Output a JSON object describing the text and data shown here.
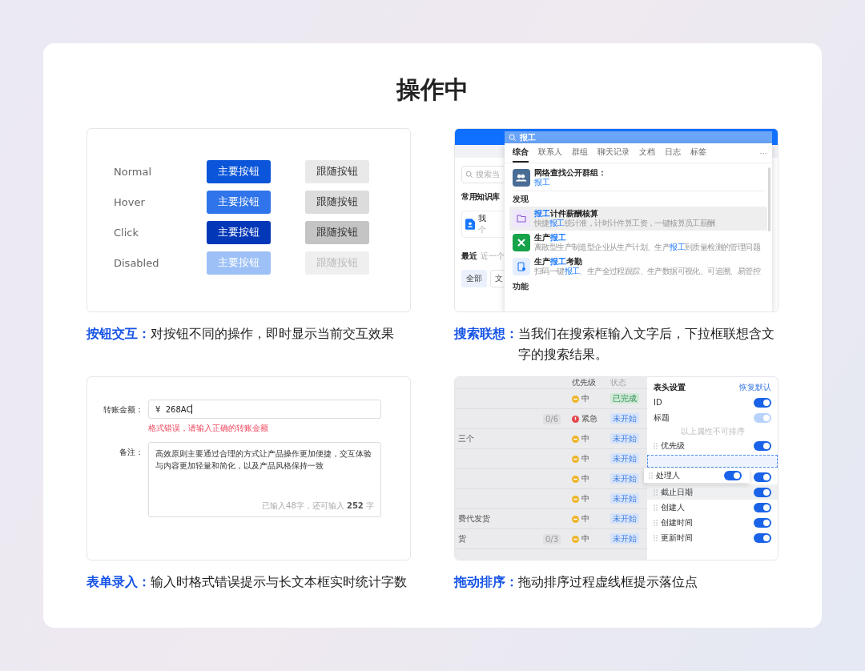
{
  "title": "操作中",
  "button_demo": {
    "rows": [
      {
        "kind": "normal",
        "label": "Normal",
        "primary": "主要按钮",
        "secondary": "跟随按钮"
      },
      {
        "kind": "hover",
        "label": "Hover",
        "primary": "主要按钮",
        "secondary": "跟随按钮"
      },
      {
        "kind": "click",
        "label": "Click",
        "primary": "主要按钮",
        "secondary": "跟随按钮"
      },
      {
        "kind": "disabled",
        "label": "Disabled",
        "primary": "主要按钮",
        "secondary": "跟随按钮"
      }
    ],
    "caption": {
      "label": "按钮交互：",
      "text": "对按钮不同的操作，即时显示当前交互效果"
    }
  },
  "search_demo": {
    "page": {
      "search_placeholder": "搜索当",
      "section_title": "常用知识库",
      "card_title": "我",
      "card_subtitle": "个",
      "recent_title": "最近",
      "recent_hint": "近一个",
      "chips": [
        {
          "label": "全部",
          "selected": true
        },
        {
          "label": "文",
          "selected": false
        }
      ]
    },
    "query": "报工",
    "tabs": [
      {
        "label": "综合",
        "selected": true
      },
      {
        "label": "联系人",
        "selected": false
      },
      {
        "label": "群组",
        "selected": false
      },
      {
        "label": "聊天记录",
        "selected": false
      },
      {
        "label": "文档",
        "selected": false
      },
      {
        "label": "日志",
        "selected": false
      },
      {
        "label": "标签",
        "selected": false
      }
    ],
    "more": "···",
    "group_row": {
      "title": "网络查找公开群组：",
      "keyword": "报工"
    },
    "sections": [
      {
        "title": "发现",
        "items": [
          {
            "kind": "salary",
            "selected": true,
            "title": [
              {
                "text": "报工",
                "match": true
              },
              {
                "text": "计件薪酬核算",
                "match": false
              }
            ],
            "description": [
              {
                "text": "快捷",
                "match": false
              },
              {
                "text": "报工",
                "match": true
              },
              {
                "text": "统计准，计时计件算工资，一键核算员工薪酬",
                "match": false
              }
            ]
          },
          {
            "kind": "tools",
            "selected": false,
            "title": [
              {
                "text": "生产",
                "match": false
              },
              {
                "text": "报工",
                "match": true
              }
            ],
            "description": [
              {
                "text": "离散型生产制造型企业从生产计划、生产",
                "match": false
              },
              {
                "text": "报工",
                "match": true
              },
              {
                "text": "到质量检测的管理问题",
                "match": false
              }
            ]
          },
          {
            "kind": "attendance",
            "selected": false,
            "title": [
              {
                "text": "生产",
                "match": false
              },
              {
                "text": "报工",
                "match": true
              },
              {
                "text": "考勤",
                "match": false
              }
            ],
            "description": [
              {
                "text": "扫码一键",
                "match": false
              },
              {
                "text": "报工",
                "match": true
              },
              {
                "text": "、生产全过程跟踪、生产数据可视化、可追溯、易管控",
                "match": false
              }
            ]
          }
        ]
      },
      {
        "title": "功能"
      }
    ],
    "caption": {
      "label": "搜索联想：",
      "text": "当我们在搜索框输入文字后，下拉框联想含文字的搜索结果。"
    }
  },
  "form_demo": {
    "amount_label": "转账金额：",
    "amount_value": "¥  268AC",
    "error": "格式错误，请输入正确的转账金额",
    "note_label": "备注：",
    "note_value": "高效原则主要通过合理的方式让产品操作更加便捷，交互体验与内容更加轻量和简化，以及产品风格保持一致",
    "counter": "已输入48字，还可输入 **252** 字",
    "caption": {
      "label": "表单录入：",
      "text": "输入时格式错误提示与长文本框实时统计字数"
    }
  },
  "sort_demo": {
    "columns": [
      "优先级",
      "状态"
    ],
    "rows": [
      {
        "priority": {
          "text": "中",
          "kind": "normal"
        },
        "status": {
          "text": "已完成",
          "kind": "done"
        }
      },
      {
        "count": "0/6",
        "priority": {
          "text": "紧急",
          "kind": "urgent"
        },
        "status": {
          "text": "未开始",
          "kind": "todo"
        }
      },
      {
        "title": "三个",
        "priority": {
          "text": "中",
          "kind": "normal"
        },
        "status": {
          "text": "未开始",
          "kind": "todo"
        }
      },
      {
        "priority": {
          "text": "中",
          "kind": "normal"
        },
        "status": {
          "text": "未开始",
          "kind": "todo"
        }
      },
      {
        "priority": {
          "text": "中",
          "kind": "normal"
        },
        "status": {
          "text": "未开始",
          "kind": "todo"
        }
      },
      {
        "priority": {
          "text": "中",
          "kind": "normal"
        },
        "status": {
          "text": "未开始",
          "kind": "todo"
        }
      },
      {
        "title": "费代发货",
        "priority": {
          "text": "中",
          "kind": "normal"
        },
        "status": {
          "text": "未开始",
          "kind": "todo"
        }
      },
      {
        "title": "货",
        "count": "0/3",
        "priority": {
          "text": "中",
          "kind": "normal"
        },
        "status": {
          "text": "未开始",
          "kind": "todo"
        }
      }
    ],
    "settings": {
      "title": "表头设置",
      "reset": "恢复默认",
      "fixed": [
        {
          "label": "ID",
          "on": true,
          "disabled": false
        },
        {
          "label": "标题",
          "on": true,
          "disabled": true
        }
      ],
      "divider": "以上属性不可排序",
      "sortable": [
        {
          "kind": "item",
          "label": "优先级",
          "on": true,
          "highlighted": false
        },
        {
          "kind": "drop_zone"
        },
        {
          "kind": "item",
          "on": true,
          "highlighted": false
        },
        {
          "kind": "item",
          "label": "截止日期",
          "on": true,
          "highlighted": true
        },
        {
          "kind": "item",
          "label": "创建人",
          "on": true,
          "highlighted": false
        },
        {
          "kind": "item",
          "label": "创建时间",
          "on": true,
          "highlighted": false
        },
        {
          "kind": "item",
          "label": "更新时间",
          "on": true,
          "highlighted": false
        }
      ],
      "dragging": {
        "label": "处理人",
        "on": true
      }
    },
    "caption": {
      "label": "拖动排序：",
      "text": "拖动排序过程虚线框提示落位点"
    }
  }
}
